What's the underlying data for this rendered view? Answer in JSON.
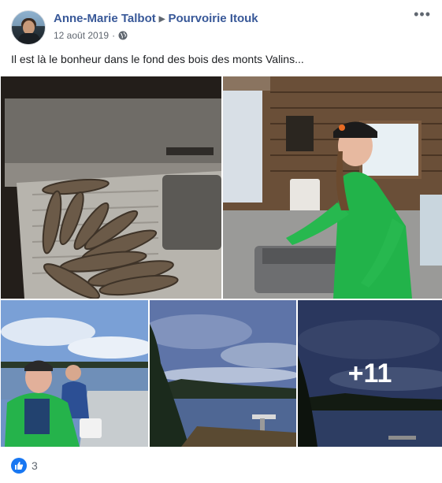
{
  "post": {
    "author": "Anne-Marie Talbot",
    "target_page": "Pourvoirie Itouk",
    "date": "12 août 2019",
    "separator": "·",
    "audience_icon": "globe-icon",
    "more_label": "•••",
    "text": "Il est là le bonheur dans le fond des bois des monts Valins..."
  },
  "photos": {
    "extra_count_label": "+11"
  },
  "reactions": {
    "icon": "like-icon",
    "count": "3"
  },
  "colors": {
    "link": "#385898",
    "secondary_text": "#606770",
    "like_blue": "#1877f2"
  }
}
